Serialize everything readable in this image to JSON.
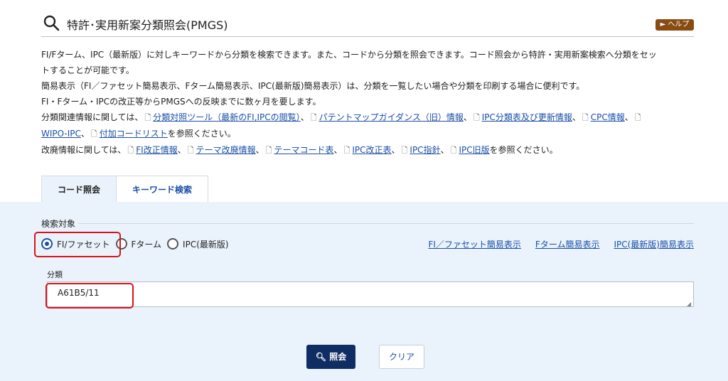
{
  "header": {
    "title": "特許･実用新案分類照会(PMGS)",
    "help_label": "► ヘルプ",
    "icon": "search-icon"
  },
  "description": {
    "line1": "FI/Fターム、IPC（最新版）に対しキーワードから分類を検索できます。また、コードから分類を照会できます。コード照会から特許・実用新案検索へ分類をセッ",
    "line2": "トすることが可能です。",
    "line3": "簡易表示（FI／ファセット簡易表示、Fターム簡易表示、IPC(最新版)簡易表示）は、分類を一覧したい場合や分類を印刷する場合に便利です。",
    "line4": "FI・Fターム・IPCの改正等からPMGSへの反映までに数ヶ月を要します。",
    "related_prefix": "分類関連情報に関しては、",
    "related_links": [
      "分類対照ツール（最新のFI,IPCの閲覧）",
      "パテントマップガイダンス（旧）情報",
      "IPC分類表及び更新情報",
      "CPC情報",
      "WIPO-IPC",
      "付加コードリスト"
    ],
    "related_suffix": "を参照ください。",
    "revision_prefix": "改廃情報に関しては、",
    "revision_links": [
      "FI改正情報",
      "テーマ改廃情報",
      "テーマコード表",
      "IPC改正表",
      "IPC指針",
      "IPC旧版"
    ],
    "revision_suffix": "を参照ください。",
    "separator": "、",
    "doc_icon": "document-icon"
  },
  "tabs": [
    {
      "label": "コード照会",
      "active": true
    },
    {
      "label": "キーワード検索",
      "active": false
    }
  ],
  "form": {
    "target_label": "検索対象",
    "radios": [
      {
        "label": "FI/ファセット",
        "checked": true
      },
      {
        "label": "Fターム",
        "checked": false
      },
      {
        "label": "IPC(最新版)",
        "checked": false
      }
    ],
    "simple_links": [
      "FI／ファセット簡易表示",
      "Fターム簡易表示",
      "IPC(最新版)簡易表示"
    ],
    "class_label": "分類",
    "class_value": "A61B5/11",
    "query_button": "照会",
    "clear_button": "クリア"
  },
  "colors": {
    "accent": "#0f2d62",
    "link": "#1a4ea8",
    "panel_bg": "#eaf3fc",
    "highlight": "#d8131e",
    "help_bg": "#8a4b12"
  }
}
